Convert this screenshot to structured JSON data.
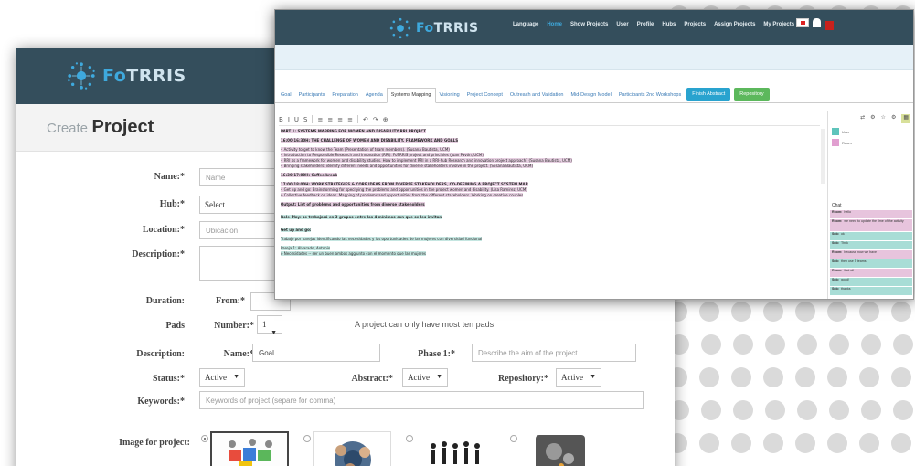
{
  "brand": {
    "fo": "Fo",
    "trris": "TRRIS"
  },
  "back": {
    "title_prefix": "Create",
    "title": "Project",
    "name_label": "Name:*",
    "name_placeholder": "Name",
    "hub_label": "Hub:*",
    "hub_value": "Select",
    "location_label": "Location:*",
    "location_placeholder": "Ubicacion",
    "description_label": "Description:*",
    "duration_label": "Duration:",
    "from_label": "From:*",
    "pads_label": "Pads",
    "number_label": "Number:*",
    "number_value": "1",
    "pads_note": "A project can only have most ten pads",
    "pad_description_label": "Description:",
    "pad_name_label": "Name:*",
    "pad_name_value": "Goal",
    "phase_label": "Phase 1:*",
    "phase_placeholder": "Describe the aim of the project",
    "status_label": "Status:*",
    "status_value": "Active",
    "abstract_label": "Abstract:*",
    "abstract_value": "Active",
    "repository_label": "Repository:*",
    "repository_value": "Active",
    "keywords_label": "Keywords:*",
    "keywords_placeholder": "Keywords of project (separe for comma)",
    "image_label": "Image for project:"
  },
  "front": {
    "topnav": [
      "Language",
      "Home",
      "Show Projects",
      "User",
      "Profile",
      "Hubs",
      "Projects",
      "Assign Projects",
      "My Projects"
    ],
    "topnav_active_index": 1,
    "tabs": [
      "Goal",
      "Participants",
      "Preparation",
      "Agenda",
      "Systems Mapping",
      "Visioning",
      "Project Concept",
      "Outreach and Validation",
      "Mid-Design Model",
      "Participants 2nd Workshops"
    ],
    "active_tab_index": 4,
    "tab_buttons": [
      {
        "label": "Finish Abstract",
        "color": "#29a3cf"
      },
      {
        "label": "Repository",
        "color": "#5cb85c"
      }
    ],
    "toolbar": [
      "B",
      "I",
      "U",
      "S",
      "≡",
      "≡",
      "≡",
      "≡",
      "↶",
      "↷",
      "⊕"
    ],
    "side_toolbar": [
      "⇄",
      "⚙",
      "☆",
      "⚙",
      "▦"
    ],
    "users": [
      {
        "name": "User",
        "color": "#5ec4bb"
      },
      {
        "name": "Room",
        "color": "#e19fd0"
      }
    ],
    "chat_title": "Chat",
    "chat": [
      {
        "who": "Room:",
        "text": "hello",
        "kind": "p"
      },
      {
        "who": "Room:",
        "text": "we need to update the time of the activity",
        "kind": "p"
      },
      {
        "who": "Sub:",
        "text": "ok",
        "kind": "t"
      },
      {
        "who": "Sub:",
        "text": "Thnk",
        "kind": "t"
      },
      {
        "who": "Room:",
        "text": "because now we have",
        "kind": "p"
      },
      {
        "who": "Sub:",
        "text": "then use 5 teams",
        "kind": "t"
      },
      {
        "who": "Room:",
        "text": "that all",
        "kind": "p"
      },
      {
        "who": "Sub:",
        "text": "good!",
        "kind": "t"
      },
      {
        "who": "Sub:",
        "text": "thanks",
        "kind": "t"
      }
    ],
    "doc_lines": [
      {
        "t": "PART 1: SYSTEMS MAPPING FOR WOMEN AND DISABILITY RRI PROJECT",
        "h": "hp",
        "b": true
      },
      {
        "t": "",
        "h": "",
        "b": false
      },
      {
        "t": "16:00-16:30H: THE CHALLENGE OF WOMEN AND DISABILITY. FRAMEWORK AND GOALS",
        "h": "hp",
        "b": true
      },
      {
        "t": "",
        "h": "",
        "b": false
      },
      {
        "t": "• Activity to get to know the Team (Presentation of team members). (Susana Bautista, UCM)",
        "h": "hp",
        "b": false
      },
      {
        "t": "• Introduction to Responsible Research and Innovation (RRI). FoTRRIS project and principles (Juan Pavón, UCM)",
        "h": "hp",
        "b": false
      },
      {
        "t": "• RRI as a framework for women and disability studies. How to implement RRI in a RRI-hub Research and innovation project approach? (Susana Bautista, UCM)",
        "h": "hp",
        "b": false
      },
      {
        "t": "• Bringing stakeholders: identify different needs and opportunities for diverse stakeholders involve in the project. (Susana Bautista, UCM)",
        "h": "hp",
        "b": false
      },
      {
        "t": "",
        "h": "",
        "b": false
      },
      {
        "t": "16:30-17:00H: Coffee break",
        "h": "hp",
        "b": true
      },
      {
        "t": "",
        "h": "",
        "b": false
      },
      {
        "t": "17:00-18:00H: WORK STRATEGIES & CORE IDEAS FROM DIVERSE STAKEHOLDERS, CO-DEFINING A PROJECT SYSTEM MAP",
        "h": "hp",
        "b": true
      },
      {
        "t": "• Get up and go: Brainstorming for specifying the problems and opportunities in the project women and disability. (Lisa Ramirez, UCM)",
        "h": "hp",
        "b": false
      },
      {
        "t": "   o Collective feedback on ideas. Mapping of problems and opportunities from the different stakeholders. Working on creative couples",
        "h": "hp",
        "b": false
      },
      {
        "t": "",
        "h": "",
        "b": false
      },
      {
        "t": "Output: List of problems and opportunities from diverse stakeholders",
        "h": "hp",
        "b": true
      },
      {
        "t": "",
        "h": "",
        "b": false
      },
      {
        "t": "",
        "h": "",
        "b": false
      },
      {
        "t": "Role-Play: se trabajará en 3 grupos entre los 4 mínimos con que se les invitan",
        "h": "ht",
        "b": true
      },
      {
        "t": "",
        "h": "",
        "b": false
      },
      {
        "t": "",
        "h": "",
        "b": false
      },
      {
        "t": "Get up and go:",
        "h": "ht",
        "b": true
      },
      {
        "t": "",
        "h": "",
        "b": false
      },
      {
        "t": "Trabajo por parejas identificando las necesidades y las oportunidades de las mujeres con diversidad funcional",
        "h": "ht",
        "b": false
      },
      {
        "t": "",
        "h": "",
        "b": false
      },
      {
        "t": "Pareja 1: Alvarado, Antonio",
        "h": "ht",
        "b": false
      },
      {
        "t": "   o Necesidades -- ser un buen ambos aggiunto con el momento que las mujeres",
        "h": "ht",
        "b": false
      }
    ]
  }
}
